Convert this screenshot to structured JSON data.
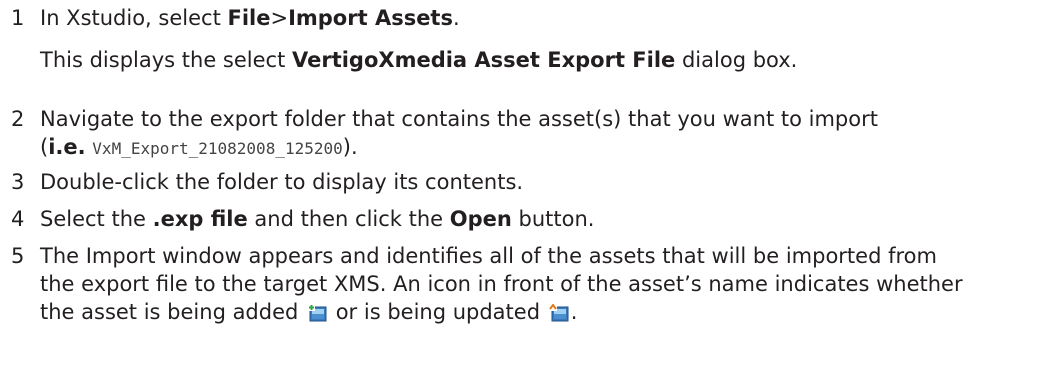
{
  "steps": [
    {
      "number": "1",
      "prefix": "In Xstudio, select ",
      "bold1": "File",
      "sep": ">",
      "bold2": "Import Assets",
      "suffix": ".",
      "note_prefix": "This displays the select ",
      "note_bold": "VertigoXmedia Asset Export File",
      "note_suffix": " dialog box."
    },
    {
      "number": "2",
      "line1": "Navigate to the export folder that contains the asset(s) that you want to import",
      "paren_open": "(",
      "ie_bold": "i.e.",
      "code": "VxM_Export_21082008_125200",
      "paren_close": ")."
    },
    {
      "number": "3",
      "text": "Double-click the folder to display its contents."
    },
    {
      "number": "4",
      "prefix": "Select the ",
      "bold1": ".exp file",
      "mid": " and then click the ",
      "bold2": "Open",
      "suffix": " button."
    },
    {
      "number": "5",
      "line1": "The Import window appears and identifies all of the assets that will be imported from",
      "line2": "the export file to the target XMS. An icon in front of the asset’s name indicates whether",
      "line3_a": "the asset is being added ",
      "line3_b": " or is being updated ",
      "line3_c": ".",
      "icon_added": "asset-added-icon",
      "icon_updated": "asset-updated-icon"
    }
  ]
}
